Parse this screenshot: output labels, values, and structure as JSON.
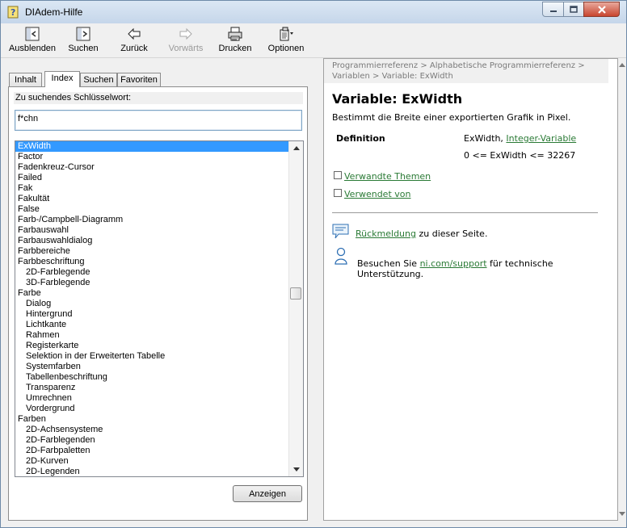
{
  "window": {
    "title": "DIAdem-Hilfe"
  },
  "toolbar": {
    "buttons": [
      {
        "label": "Ausblenden",
        "icon": "hide-pane-icon"
      },
      {
        "label": "Suchen",
        "icon": "locate-icon"
      },
      {
        "label": "Zurück",
        "icon": "back-arrow-icon"
      },
      {
        "label": "Vorwärts",
        "icon": "forward-arrow-icon"
      },
      {
        "label": "Drucken",
        "icon": "printer-icon"
      },
      {
        "label": "Optionen",
        "icon": "options-icon"
      }
    ]
  },
  "left": {
    "tabs": [
      {
        "label": "Inhalt"
      },
      {
        "label": "Index"
      },
      {
        "label": "Suchen"
      },
      {
        "label": "Favoriten"
      }
    ],
    "keyword_label": "Zu suchendes Schlüsselwort:",
    "keyword_value": "f*chn",
    "index_items": [
      {
        "text": "ExWidth",
        "level": 0,
        "selected": true
      },
      {
        "text": "Factor",
        "level": 0
      },
      {
        "text": "Fadenkreuz-Cursor",
        "level": 0
      },
      {
        "text": "Failed",
        "level": 0
      },
      {
        "text": "Fak",
        "level": 0
      },
      {
        "text": "Fakultät",
        "level": 0
      },
      {
        "text": "False",
        "level": 0
      },
      {
        "text": "Farb-/Campbell-Diagramm",
        "level": 0
      },
      {
        "text": "Farbauswahl",
        "level": 0
      },
      {
        "text": "Farbauswahldialog",
        "level": 0
      },
      {
        "text": "Farbbereiche",
        "level": 0
      },
      {
        "text": "Farbbeschriftung",
        "level": 0
      },
      {
        "text": "2D-Farblegende",
        "level": 1
      },
      {
        "text": "3D-Farblegende",
        "level": 1
      },
      {
        "text": "Farbe",
        "level": 0
      },
      {
        "text": "Dialog",
        "level": 1
      },
      {
        "text": "Hintergrund",
        "level": 1
      },
      {
        "text": "Lichtkante",
        "level": 1
      },
      {
        "text": "Rahmen",
        "level": 1
      },
      {
        "text": "Registerkarte",
        "level": 1
      },
      {
        "text": "Selektion in der Erweiterten Tabelle",
        "level": 1
      },
      {
        "text": "Systemfarben",
        "level": 1
      },
      {
        "text": "Tabellenbeschriftung",
        "level": 1
      },
      {
        "text": "Transparenz",
        "level": 1
      },
      {
        "text": "Umrechnen",
        "level": 1
      },
      {
        "text": "Vordergrund",
        "level": 1
      },
      {
        "text": "Farben",
        "level": 0
      },
      {
        "text": "2D-Achsensysteme",
        "level": 1
      },
      {
        "text": "2D-Farblegenden",
        "level": 1
      },
      {
        "text": "2D-Farbpaletten",
        "level": 1
      },
      {
        "text": "2D-Kurven",
        "level": 1
      },
      {
        "text": "2D-Legenden",
        "level": 1
      }
    ],
    "show_button": "Anzeigen"
  },
  "right": {
    "breadcrumb_line1": "Programmierreferenz > Alphabetische Programmierreferenz >",
    "breadcrumb_line2": "Variablen > Variable: ExWidth",
    "title": "Variable: ExWidth",
    "description": "Bestimmt die Breite einer exportierten Grafik in Pixel.",
    "definition_label": "Definition",
    "definition_name": "ExWidth, ",
    "definition_type_link": "Integer-Variable",
    "definition_range": "0 <= ExWidth <= 32267",
    "related_topics": "Verwandte Themen",
    "used_by": "Verwendet von",
    "feedback_link": "Rückmeldung",
    "feedback_text": " zu dieser Seite.",
    "support_prefix": "Besuchen Sie ",
    "support_link": "ni.com/support",
    "support_suffix": " für technische Unterstützung."
  }
}
